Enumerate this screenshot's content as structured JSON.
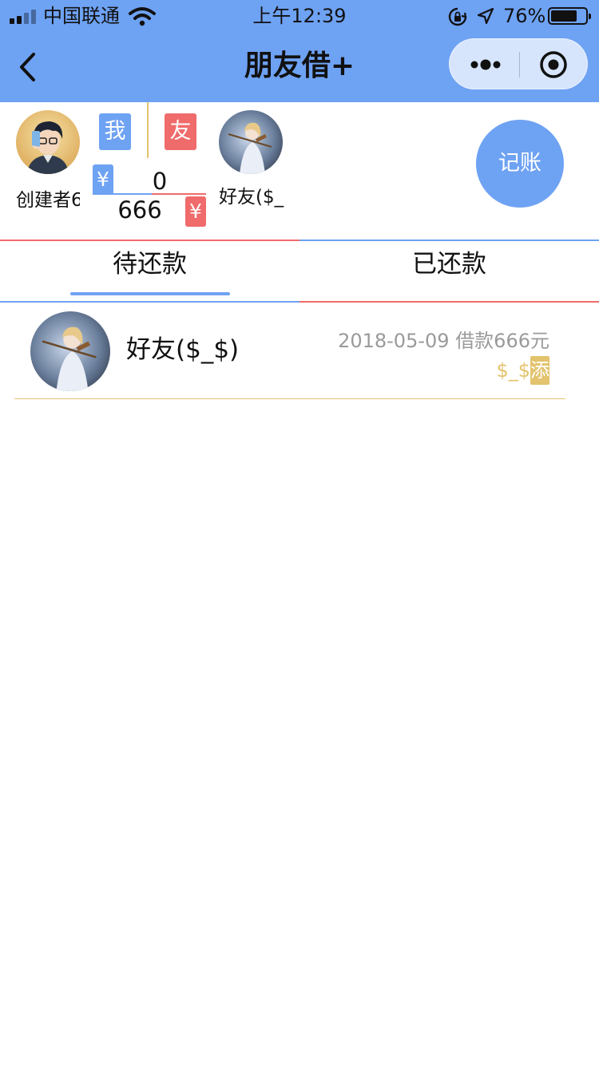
{
  "status_bar": {
    "carrier": "中国联通",
    "time": "上午12:39",
    "battery_percent": "76%",
    "battery_level": 0.76
  },
  "nav": {
    "title": "朋友借+"
  },
  "summary": {
    "me": {
      "name": "创建者6",
      "tag": "我",
      "currency": "¥",
      "amount": "0"
    },
    "friend": {
      "name": "好友($_$)",
      "tag": "友",
      "currency": "¥",
      "amount": "666"
    },
    "record_button": "记账"
  },
  "tabs": [
    {
      "label": "待还款",
      "active": true
    },
    {
      "label": "已还款",
      "active": false
    }
  ],
  "list": [
    {
      "name": "好友($_$)",
      "date": "2018-05-09",
      "description": "借款666元",
      "note": "$_$",
      "add_label": "添"
    }
  ],
  "colors": {
    "nav_bg": "#6ea2f3",
    "blue": "#6ea2f3",
    "red": "#f06b6b",
    "gold": "#e3c36d",
    "meta_gray": "#9a9a9a"
  }
}
